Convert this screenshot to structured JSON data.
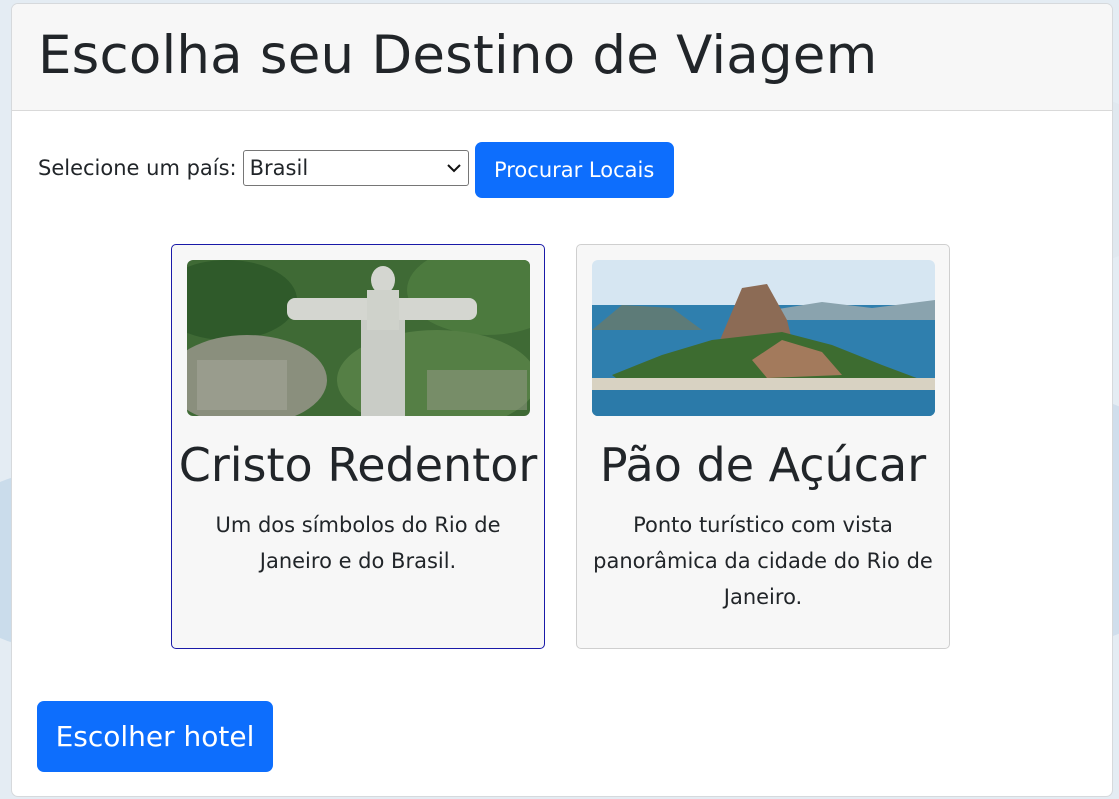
{
  "page": {
    "title": "Escolha seu Destino de Viagem"
  },
  "filter": {
    "label": "Selecione um país:",
    "selected_country": "Brasil",
    "search_button": "Procurar Locais"
  },
  "destinations": [
    {
      "name": "Cristo Redentor",
      "description": "Um dos símbolos do Rio de Janeiro e do Brasil.",
      "selected": true
    },
    {
      "name": "Pão de Açúcar",
      "description": "Ponto turístico com vista panorâmica da cidade do Rio de Janeiro.",
      "selected": false
    }
  ],
  "actions": {
    "choose_hotel": "Escolher hotel"
  },
  "colors": {
    "primary": "#0d6efd",
    "selected_border": "#1a1aa8"
  }
}
